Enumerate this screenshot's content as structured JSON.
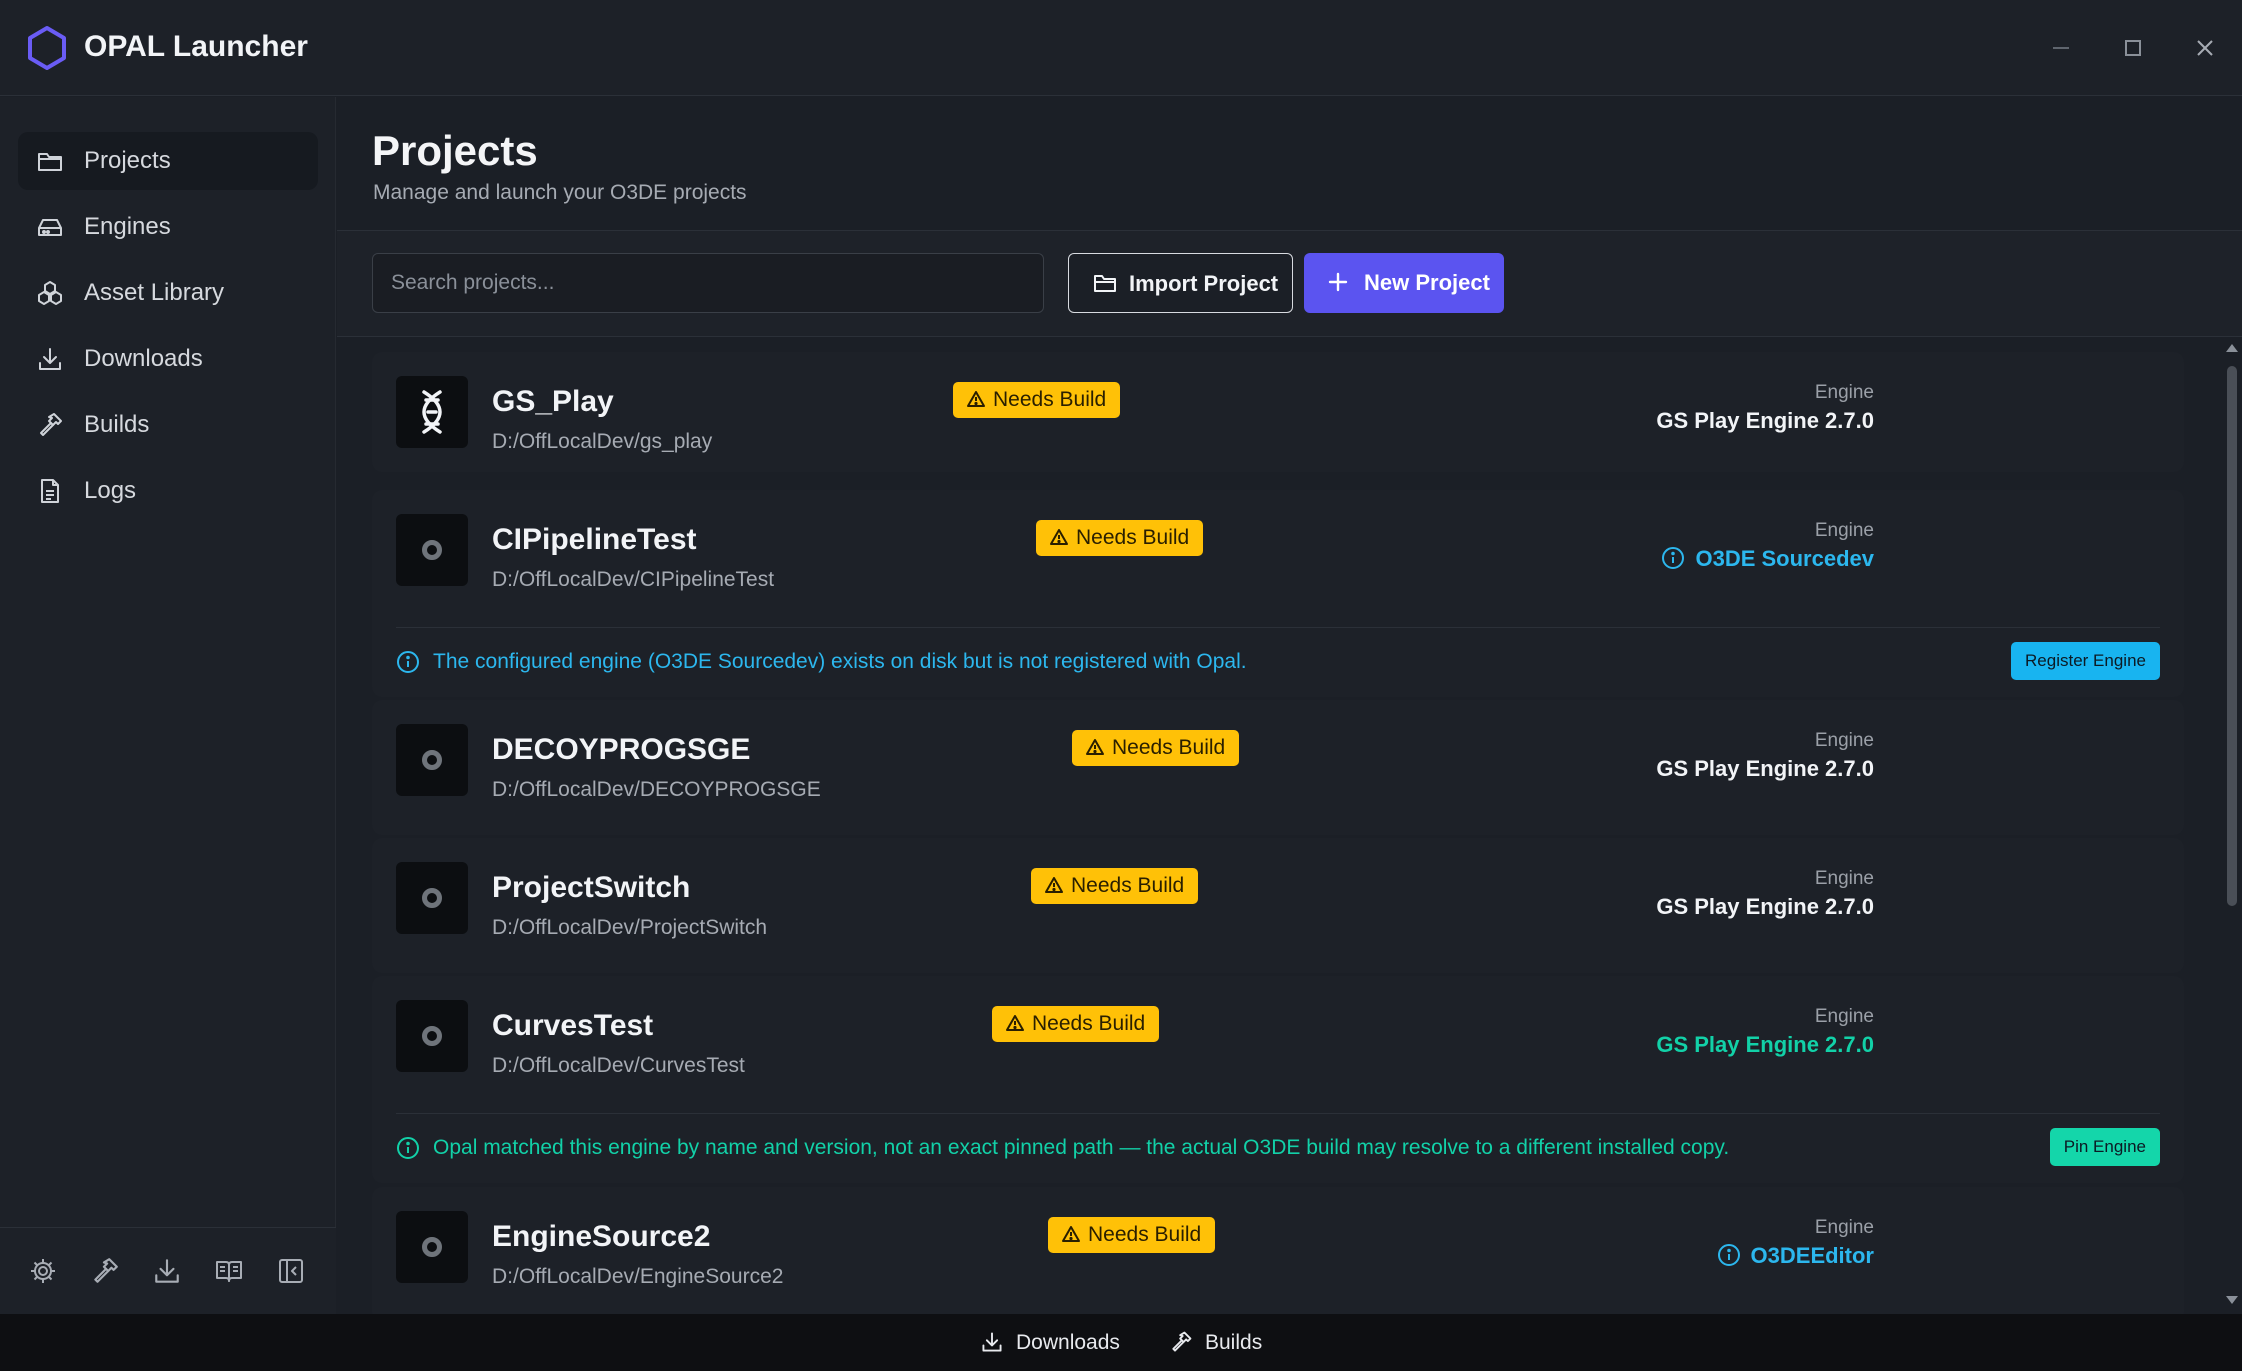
{
  "app": {
    "title": "OPAL Launcher"
  },
  "sidebar": {
    "items": [
      {
        "label": "Projects",
        "icon": "folder-icon",
        "active": true
      },
      {
        "label": "Engines",
        "icon": "drive-icon"
      },
      {
        "label": "Asset Library",
        "icon": "boxes-icon"
      },
      {
        "label": "Downloads",
        "icon": "download-icon"
      },
      {
        "label": "Builds",
        "icon": "hammer-icon"
      },
      {
        "label": "Logs",
        "icon": "file-text-icon"
      }
    ],
    "footer_icons": [
      "gear-icon",
      "hammer-icon",
      "download-icon",
      "book-icon",
      "collapse-sidebar-icon"
    ]
  },
  "header": {
    "title": "Projects",
    "subtitle": "Manage and launch your O3DE projects"
  },
  "toolbar": {
    "search_placeholder": "Search projects...",
    "import_label": "Import Project",
    "new_label": "New Project"
  },
  "projects": [
    {
      "name": "GS_Play",
      "badge": "Needs Build",
      "path": "D:/OffLocalDev/gs_play",
      "engine_label": "Engine",
      "engine": "GS Play Engine 2.7.0",
      "engine_style": "normal",
      "thumb": "dna-icon"
    },
    {
      "name": "CIPipelineTest",
      "badge": "Needs Build",
      "path": "D:/OffLocalDev/CIPipelineTest",
      "engine_label": "Engine",
      "engine": "O3DE Sourcedev",
      "engine_style": "blue",
      "notice": {
        "text": "The configured engine (O3DE Sourcedev) exists on disk but is not registered with Opal.",
        "action": "Register Engine",
        "color": "#2cb7ee"
      }
    },
    {
      "name": "DECOYPROGSGE",
      "badge": "Needs Build",
      "path": "D:/OffLocalDev/DECOYPROGSGE",
      "engine_label": "Engine",
      "engine": "GS Play Engine 2.7.0",
      "engine_style": "normal"
    },
    {
      "name": "ProjectSwitch",
      "badge": "Needs Build",
      "path": "D:/OffLocalDev/ProjectSwitch",
      "engine_label": "Engine",
      "engine": "GS Play Engine 2.7.0",
      "engine_style": "normal"
    },
    {
      "name": "CurvesTest",
      "badge": "Needs Build",
      "path": "D:/OffLocalDev/CurvesTest",
      "engine_label": "Engine",
      "engine": "GS Play Engine 2.7.0",
      "engine_style": "teal",
      "notice": {
        "text": "Opal matched this engine by name and version, not an exact pinned path — the actual O3DE build may resolve to a different installed copy.",
        "action": "Pin Engine",
        "color": "#12d1a8"
      }
    },
    {
      "name": "EngineSource2",
      "badge": "Needs Build",
      "path": "D:/OffLocalDev/EngineSource2",
      "engine_label": "Engine",
      "engine": "O3DEEditor",
      "engine_style": "blue"
    }
  ],
  "statusbar": {
    "downloads_label": "Downloads",
    "builds_label": "Builds"
  },
  "colors": {
    "accent": "#5b54f0",
    "badge": "#ffc107",
    "info_blue": "#2cb7ee",
    "info_teal": "#12d1a8"
  }
}
